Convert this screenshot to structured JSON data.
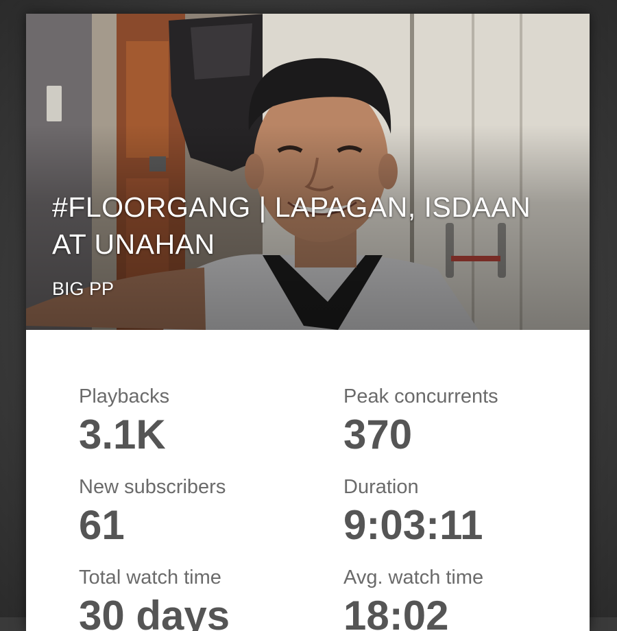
{
  "stream": {
    "title": "#FLOORGANG | LAPAGAN, ISDAAN AT UNAHAN",
    "channel": "BIG PP"
  },
  "stats": [
    {
      "label": "Playbacks",
      "value": "3.1K"
    },
    {
      "label": "Peak concurrents",
      "value": "370"
    },
    {
      "label": "New subscribers",
      "value": "61"
    },
    {
      "label": "Duration",
      "value": "9:03:11"
    },
    {
      "label": "Total watch time",
      "value": "30 days"
    },
    {
      "label": "Avg. watch time",
      "value": "18:02"
    }
  ]
}
